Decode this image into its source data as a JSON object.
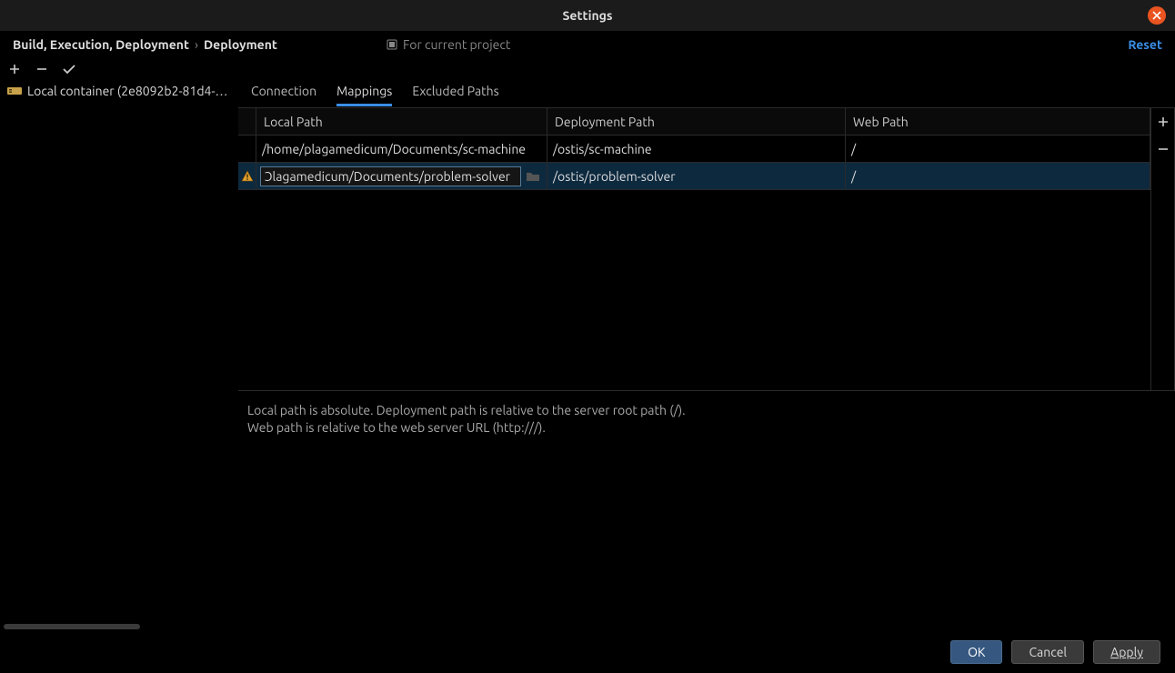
{
  "window": {
    "title": "Settings"
  },
  "breadcrumb": {
    "part1": "Build, Execution, Deployment",
    "sep": "›",
    "part2": "Deployment"
  },
  "scope": {
    "label": "For current project"
  },
  "reset": {
    "label": "Reset"
  },
  "sidebar": {
    "items": [
      {
        "label": "Local container (2e8092b2-81d4-…"
      }
    ]
  },
  "tabs": {
    "connection": "Connection",
    "mappings": "Mappings",
    "excluded": "Excluded Paths"
  },
  "table": {
    "headers": {
      "local": "Local Path",
      "deploy": "Deployment Path",
      "web": "Web Path"
    },
    "rows": [
      {
        "icon": "",
        "local": "/home/plagamedicum/Documents/sc-machine",
        "deploy": "/ostis/sc-machine",
        "web": "/"
      },
      {
        "icon": "warn",
        "local_edit": "ɔlagamedicum/Documents/problem-solver",
        "deploy": "/ostis/problem-solver",
        "web": "/"
      }
    ]
  },
  "help": {
    "line1": "Local path is absolute. Deployment path is relative to the server root path (/).",
    "line2": "Web path is relative to the web server URL (http:///)."
  },
  "buttons": {
    "ok": "OK",
    "cancel": "Cancel",
    "apply": "Apply"
  }
}
